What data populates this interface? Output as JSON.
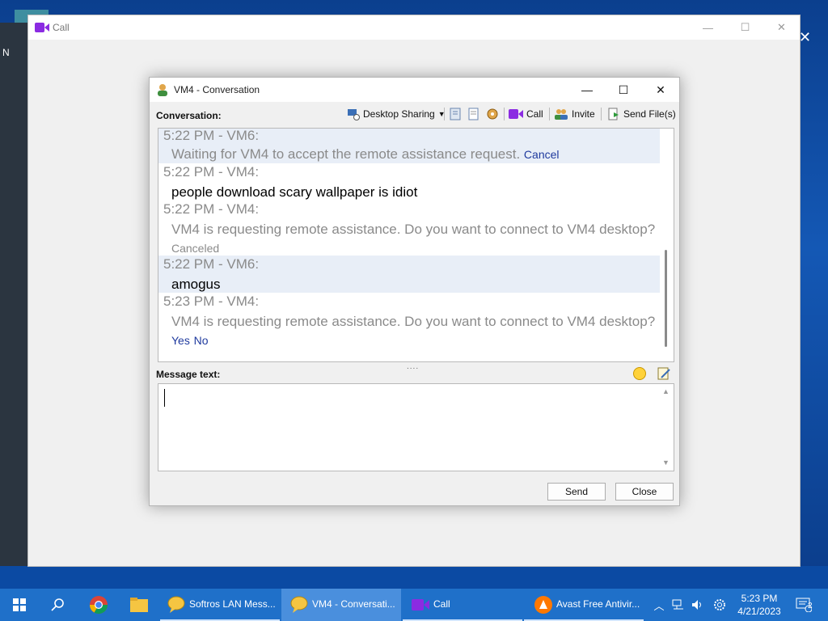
{
  "desktop": {
    "left_text": "N",
    "right_close": "✕"
  },
  "call_window": {
    "title": "Call",
    "minimize": "—",
    "maximize": "☐",
    "close": "✕"
  },
  "conversation": {
    "title": "VM4 - Conversation",
    "minimize": "—",
    "maximize": "☐",
    "close": "✕",
    "conversation_label": "Conversation:",
    "toolbar": {
      "desktop_sharing": "Desktop Sharing",
      "call": "Call",
      "invite": "Invite",
      "send_files": "Send File(s)"
    },
    "messages": [
      {
        "header": "5:22 PM - VM6:",
        "body": "Waiting for VM4 to accept the remote assistance request.",
        "action": "Cancel"
      },
      {
        "header": "5:22 PM - VM4:",
        "body": "people download scary wallpaper is idiot"
      },
      {
        "header": "5:22 PM - VM4:",
        "body": "VM4 is requesting remote assistance. Do you want to connect to VM4 desktop?",
        "status": "Canceled"
      },
      {
        "header": "5:22 PM - VM6:",
        "body": "amogus"
      },
      {
        "header": "5:23 PM - VM4:",
        "body": "VM4 is requesting remote assistance. Do you want to connect to VM4 desktop?",
        "yes": "Yes",
        "no": "No"
      }
    ],
    "splitter": "....",
    "message_text_label": "Message text:",
    "message_input_value": "",
    "send_button": "Send",
    "close_button": "Close"
  },
  "taskbar": {
    "apps": [
      {
        "label": "Softros LAN Mess..."
      },
      {
        "label": "VM4 - Conversati..."
      },
      {
        "label": "Call"
      },
      {
        "label": "Avast Free Antivir..."
      }
    ],
    "clock_time": "5:23 PM",
    "clock_date": "4/21/2023",
    "notification_count": "2"
  },
  "colors": {
    "accent_link": "#1f3a9e",
    "highlight_row": "#e8eef7",
    "taskbar": "#1f70c9",
    "call_icon": "#8b2be2"
  }
}
